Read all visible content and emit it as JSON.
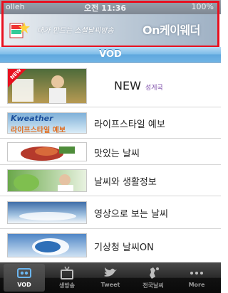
{
  "status_bar": {
    "carrier": "olleh",
    "time": "오전 11:36",
    "battery": "100%"
  },
  "banner": {
    "tagline": "내가 만드는 소셜날씨방송",
    "brand": "On케이웨더"
  },
  "navbar": {
    "title": "VOD"
  },
  "list": [
    {
      "label": "NEW",
      "sub": "성게국"
    },
    {
      "label": "라이프스타일 예보"
    },
    {
      "label": "맛있는 날씨"
    },
    {
      "label": "날씨와 생활정보"
    },
    {
      "label": "영상으로 보는 날씨"
    },
    {
      "label": "기상청 날씨ON"
    }
  ],
  "thumb_text": {
    "new_badge": "NEW",
    "kweather_top": "Kweather",
    "kweather_bottom": "라이프스타일 예보"
  },
  "tabs": [
    {
      "label": "VOD",
      "icon": "vod-icon",
      "active": true
    },
    {
      "label": "생방송",
      "icon": "live-tv-icon"
    },
    {
      "label": "Tweet",
      "icon": "twitter-bird-icon"
    },
    {
      "label": "전국날씨",
      "icon": "weather-icon"
    },
    {
      "label": "More",
      "icon": "more-icon"
    }
  ],
  "colors": {
    "highlight_border": "#e8101f",
    "navbar_blue": "#6fb3e4",
    "tabbar_dark": "#111111"
  }
}
